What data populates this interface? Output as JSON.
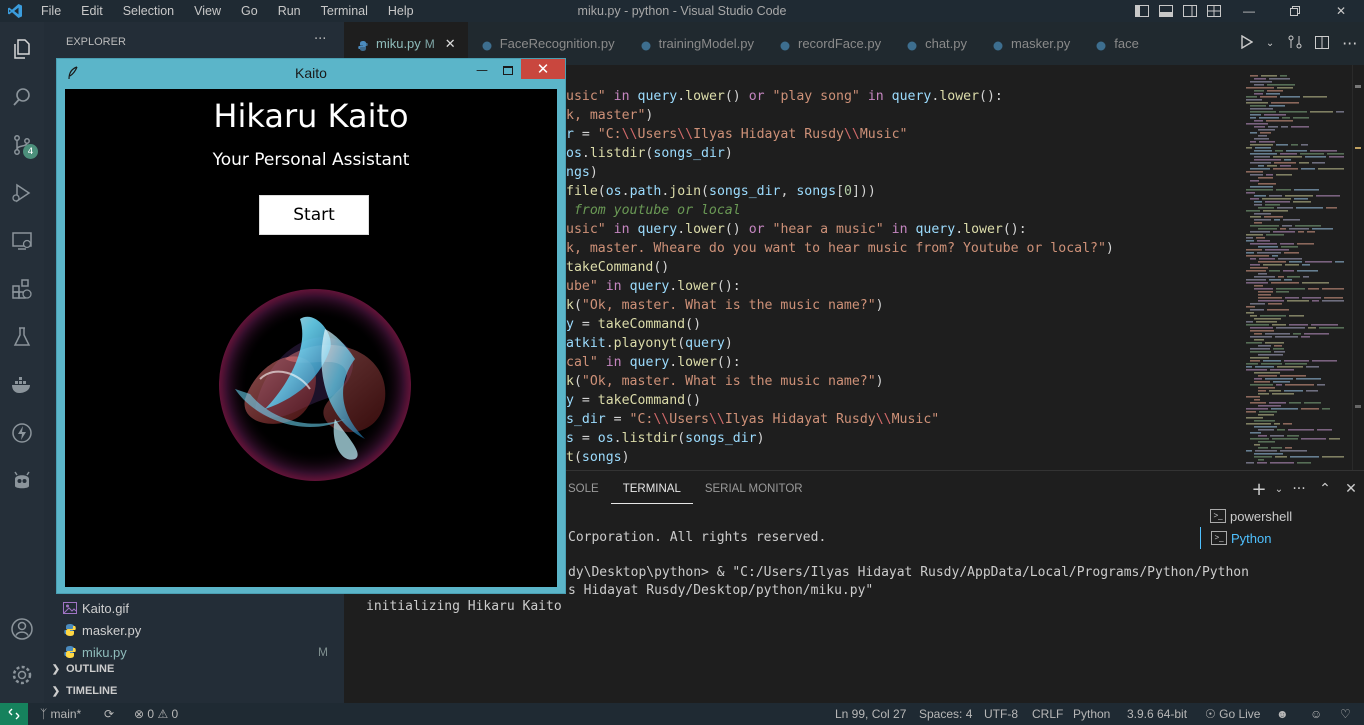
{
  "titlebar": {
    "menu": [
      "File",
      "Edit",
      "Selection",
      "View",
      "Go",
      "Run",
      "Terminal",
      "Help"
    ],
    "window_title": "miku.py - python - Visual Studio Code"
  },
  "activity": {
    "source_control_badge": "4"
  },
  "sidebar": {
    "header": "EXPLORER",
    "more": "···",
    "files": [
      {
        "name": "Kaito.gif",
        "icon": "gif-icon",
        "modified": ""
      },
      {
        "name": "masker.py",
        "icon": "python-icon",
        "modified": ""
      },
      {
        "name": "miku.py",
        "icon": "python-icon",
        "modified": "M"
      }
    ],
    "sections": [
      "OUTLINE",
      "TIMELINE"
    ]
  },
  "tabs": [
    {
      "name": "miku.py",
      "modified": "M",
      "active": true
    },
    {
      "name": "FaceRecognition.py",
      "modified": "",
      "active": false
    },
    {
      "name": "trainingModel.py",
      "modified": "",
      "active": false
    },
    {
      "name": "recordFace.py",
      "modified": "",
      "active": false
    },
    {
      "name": "chat.py",
      "modified": "",
      "active": false
    },
    {
      "name": "masker.py",
      "modified": "",
      "active": false
    },
    {
      "name": "face",
      "modified": "",
      "active": false
    }
  ],
  "code_lines": [
    [
      [
        "tk-str",
        "usic\""
      ],
      [
        "tk-pl",
        " "
      ],
      [
        "tk-kw",
        "in"
      ],
      [
        "tk-pl",
        " "
      ],
      [
        "tk-var",
        "query"
      ],
      [
        "tk-pl",
        "."
      ],
      [
        "tk-fn",
        "lower"
      ],
      [
        "tk-pl",
        "() "
      ],
      [
        "tk-kw",
        "or"
      ],
      [
        "tk-pl",
        " "
      ],
      [
        "tk-str",
        "\"play song\""
      ],
      [
        "tk-pl",
        " "
      ],
      [
        "tk-kw",
        "in"
      ],
      [
        "tk-pl",
        " "
      ],
      [
        "tk-var",
        "query"
      ],
      [
        "tk-pl",
        "."
      ],
      [
        "tk-fn",
        "lower"
      ],
      [
        "tk-pl",
        "():"
      ]
    ],
    [
      [
        "tk-str",
        "k, master\""
      ],
      [
        "tk-pl",
        ")"
      ]
    ],
    [
      [
        "tk-var",
        "r"
      ],
      [
        "tk-pl",
        " = "
      ],
      [
        "tk-str",
        "\"C:"
      ],
      [
        "tk-key",
        "\\\\"
      ],
      [
        "tk-str",
        "Users"
      ],
      [
        "tk-key",
        "\\\\"
      ],
      [
        "tk-str",
        "Ilyas Hidayat Rusdy"
      ],
      [
        "tk-key",
        "\\\\"
      ],
      [
        "tk-str",
        "Music\""
      ]
    ],
    [
      [
        "tk-var",
        "os"
      ],
      [
        "tk-pl",
        "."
      ],
      [
        "tk-fn",
        "listdir"
      ],
      [
        "tk-pl",
        "("
      ],
      [
        "tk-var",
        "songs_dir"
      ],
      [
        "tk-pl",
        ")"
      ]
    ],
    [
      [
        "tk-var",
        "ngs"
      ],
      [
        "tk-pl",
        ")"
      ]
    ],
    [
      [
        "tk-fn",
        "file"
      ],
      [
        "tk-pl",
        "("
      ],
      [
        "tk-var",
        "os"
      ],
      [
        "tk-pl",
        "."
      ],
      [
        "tk-var",
        "path"
      ],
      [
        "tk-pl",
        "."
      ],
      [
        "tk-fn",
        "join"
      ],
      [
        "tk-pl",
        "("
      ],
      [
        "tk-var",
        "songs_dir"
      ],
      [
        "tk-pl",
        ", "
      ],
      [
        "tk-var",
        "songs"
      ],
      [
        "tk-pl",
        "["
      ],
      [
        "tk-num",
        "0"
      ],
      [
        "tk-pl",
        "]))"
      ]
    ],
    [
      [
        "tk-cm",
        " from youtube or local"
      ]
    ],
    [
      [
        "tk-str",
        "usic\""
      ],
      [
        "tk-pl",
        " "
      ],
      [
        "tk-kw",
        "in"
      ],
      [
        "tk-pl",
        " "
      ],
      [
        "tk-var",
        "query"
      ],
      [
        "tk-pl",
        "."
      ],
      [
        "tk-fn",
        "lower"
      ],
      [
        "tk-pl",
        "() "
      ],
      [
        "tk-kw",
        "or"
      ],
      [
        "tk-pl",
        " "
      ],
      [
        "tk-str",
        "\"hear a music\""
      ],
      [
        "tk-pl",
        " "
      ],
      [
        "tk-kw",
        "in"
      ],
      [
        "tk-pl",
        " "
      ],
      [
        "tk-var",
        "query"
      ],
      [
        "tk-pl",
        "."
      ],
      [
        "tk-fn",
        "lower"
      ],
      [
        "tk-pl",
        "():"
      ]
    ],
    [
      [
        "tk-str",
        "k, master. Wheare do you want to hear music from? Youtube or local?\""
      ],
      [
        "tk-pl",
        ")"
      ]
    ],
    [
      [
        "tk-fn",
        "takeCommand"
      ],
      [
        "tk-pl",
        "()"
      ]
    ],
    [
      [
        "tk-str",
        "ube\""
      ],
      [
        "tk-pl",
        " "
      ],
      [
        "tk-kw",
        "in"
      ],
      [
        "tk-pl",
        " "
      ],
      [
        "tk-var",
        "query"
      ],
      [
        "tk-pl",
        "."
      ],
      [
        "tk-fn",
        "lower"
      ],
      [
        "tk-pl",
        "():"
      ]
    ],
    [
      [
        "tk-fn",
        "k"
      ],
      [
        "tk-pl",
        "("
      ],
      [
        "tk-str",
        "\"Ok, master. What is the music name?\""
      ],
      [
        "tk-pl",
        ")"
      ]
    ],
    [
      [
        "tk-var",
        "y"
      ],
      [
        "tk-pl",
        " = "
      ],
      [
        "tk-fn",
        "takeCommand"
      ],
      [
        "tk-pl",
        "()"
      ]
    ],
    [
      [
        "tk-var",
        "atkit"
      ],
      [
        "tk-pl",
        "."
      ],
      [
        "tk-fn",
        "playonyt"
      ],
      [
        "tk-pl",
        "("
      ],
      [
        "tk-var",
        "query"
      ],
      [
        "tk-pl",
        ")"
      ]
    ],
    [
      [
        "tk-str",
        "cal\""
      ],
      [
        "tk-pl",
        " "
      ],
      [
        "tk-kw",
        "in"
      ],
      [
        "tk-pl",
        " "
      ],
      [
        "tk-var",
        "query"
      ],
      [
        "tk-pl",
        "."
      ],
      [
        "tk-fn",
        "lower"
      ],
      [
        "tk-pl",
        "():"
      ]
    ],
    [
      [
        "tk-fn",
        "k"
      ],
      [
        "tk-pl",
        "("
      ],
      [
        "tk-str",
        "\"Ok, master. What is the music name?\""
      ],
      [
        "tk-pl",
        ")"
      ]
    ],
    [
      [
        "tk-var",
        "y"
      ],
      [
        "tk-pl",
        " = "
      ],
      [
        "tk-fn",
        "takeCommand"
      ],
      [
        "tk-pl",
        "()"
      ]
    ],
    [
      [
        "tk-var",
        "s_dir"
      ],
      [
        "tk-pl",
        " = "
      ],
      [
        "tk-str",
        "\"C:"
      ],
      [
        "tk-key",
        "\\\\"
      ],
      [
        "tk-str",
        "Users"
      ],
      [
        "tk-key",
        "\\\\"
      ],
      [
        "tk-str",
        "Ilyas Hidayat Rusdy"
      ],
      [
        "tk-key",
        "\\\\"
      ],
      [
        "tk-str",
        "Music\""
      ]
    ],
    [
      [
        "tk-var",
        "s"
      ],
      [
        "tk-pl",
        " = "
      ],
      [
        "tk-var",
        "os"
      ],
      [
        "tk-pl",
        "."
      ],
      [
        "tk-fn",
        "listdir"
      ],
      [
        "tk-pl",
        "("
      ],
      [
        "tk-var",
        "songs_dir"
      ],
      [
        "tk-pl",
        ")"
      ]
    ],
    [
      [
        "tk-fn",
        "t"
      ],
      [
        "tk-pl",
        "("
      ],
      [
        "tk-var",
        "songs"
      ],
      [
        "tk-pl",
        ")"
      ]
    ]
  ],
  "panel": {
    "tabs": [
      "SOLE",
      "TERMINAL",
      "SERIAL MONITOR"
    ],
    "active_tab": "TERMINAL",
    "terminal_lines": [
      "Corporation. All rights reserved.",
      "dy\\Desktop\\python> & \"C:/Users/Ilyas Hidayat Rusdy/AppData/Local/Programs/Python/Python",
      "s Hidayat Rusdy/Desktop/python/miku.py\"",
      "initializing Hikaru Kaito"
    ],
    "terminals": [
      {
        "name": "powershell",
        "active": false
      },
      {
        "name": "Python",
        "active": true
      }
    ]
  },
  "statusbar": {
    "branch": "main*",
    "problems": "0",
    "warnings": "0",
    "position": "Ln 99, Col 27",
    "spaces": "Spaces: 4",
    "encoding": "UTF-8",
    "eol": "CRLF",
    "language": "Python",
    "interpreter": "3.9.6 64-bit",
    "golive": "Go Live"
  },
  "kaito": {
    "window_title": "Kaito",
    "name": "Hikaru Kaito",
    "subtitle": "Your Personal Assistant",
    "start_label": "Start"
  }
}
